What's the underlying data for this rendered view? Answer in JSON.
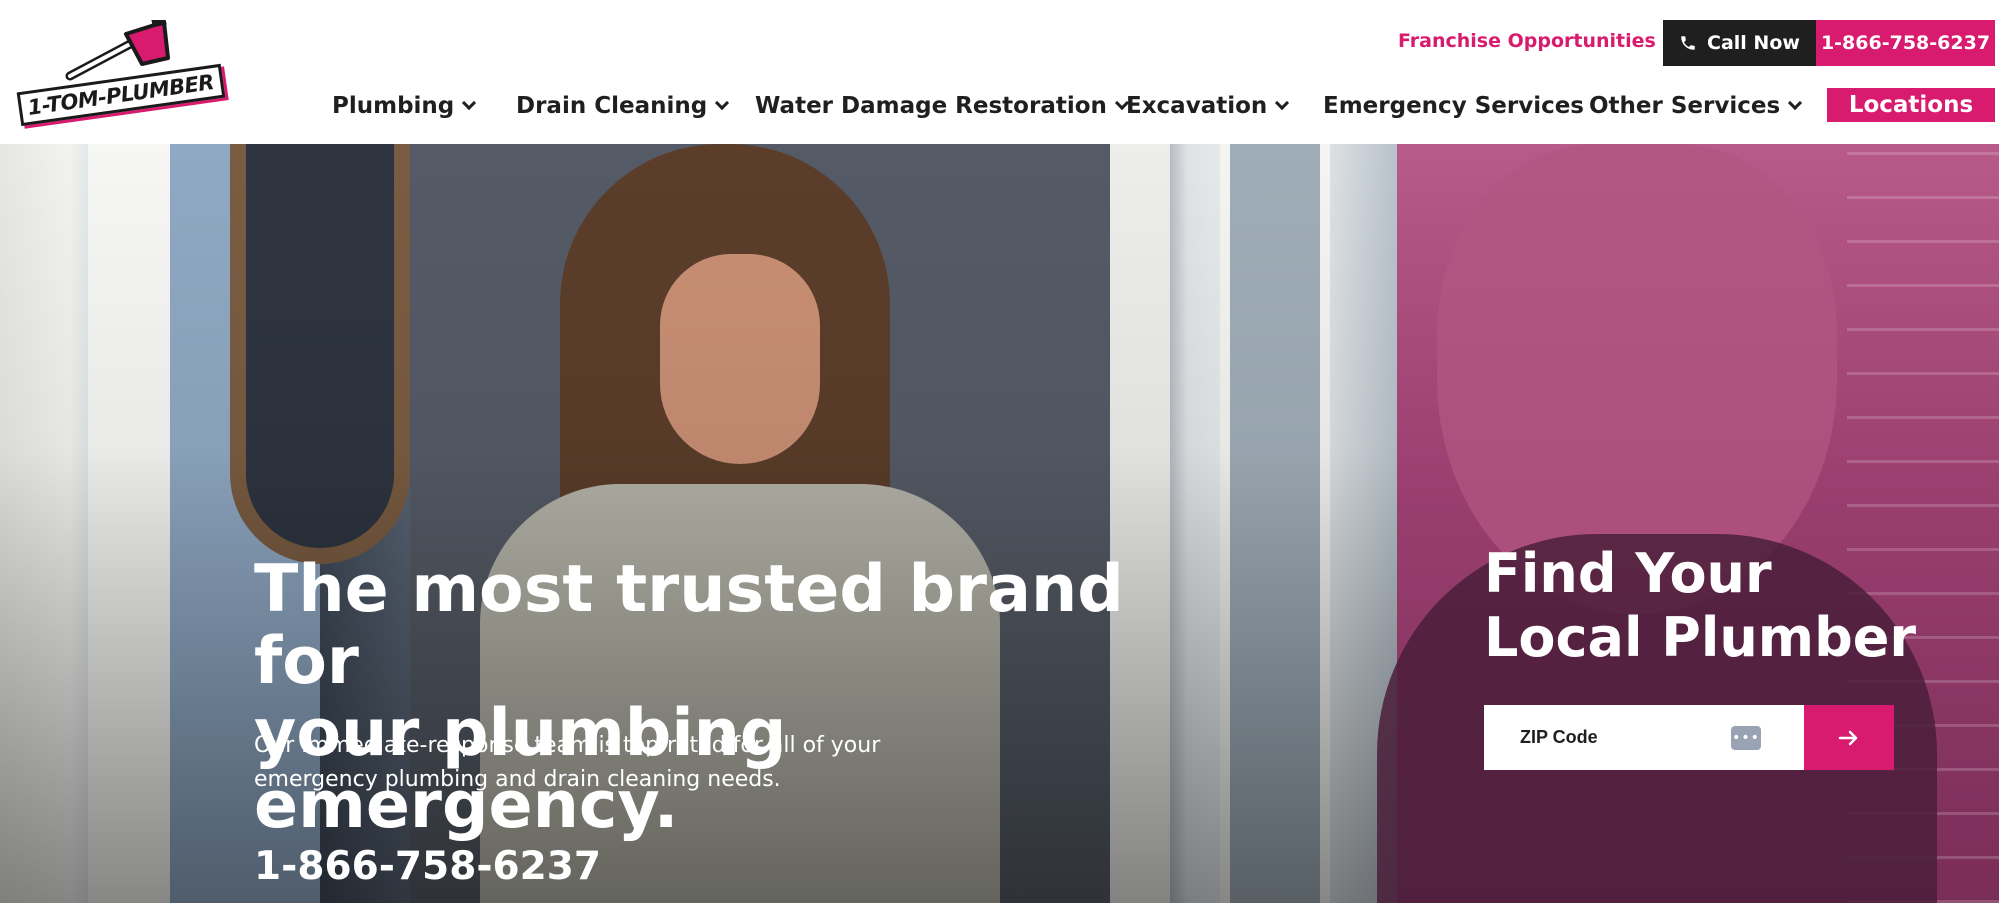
{
  "brand": {
    "logo_text": "1-TOM-PLUMBER",
    "accent_color": "#d81b6e",
    "dark_color": "#1f1f1f"
  },
  "top_bar": {
    "franchise_link": "Franchise Opportunities",
    "call_now_label": "Call Now",
    "phone_icon": "phone-icon",
    "phone_number": "1-866-758-6237"
  },
  "nav": {
    "items": [
      {
        "label": "Plumbing",
        "has_dropdown": true
      },
      {
        "label": "Drain Cleaning",
        "has_dropdown": true
      },
      {
        "label": "Water Damage Restoration",
        "has_dropdown": true
      },
      {
        "label": "Excavation",
        "has_dropdown": true
      },
      {
        "label": "Emergency Services",
        "has_dropdown": false
      },
      {
        "label": "Other Services",
        "has_dropdown": true
      }
    ],
    "locations_label": "Locations"
  },
  "hero": {
    "title_line1": "The most trusted brand for",
    "title_line2": "your plumbing emergency.",
    "subtitle_line1": "Our immediate-response team is top-rated for all of your",
    "subtitle_line2": "emergency plumbing and drain cleaning needs.",
    "phone": "1-866-758-6237"
  },
  "finder": {
    "title_line1": "Find Your",
    "title_line2": "Local Plumber",
    "zip_placeholder": "ZIP Code",
    "zip_value": "",
    "submit_icon": "arrow-right-icon"
  }
}
